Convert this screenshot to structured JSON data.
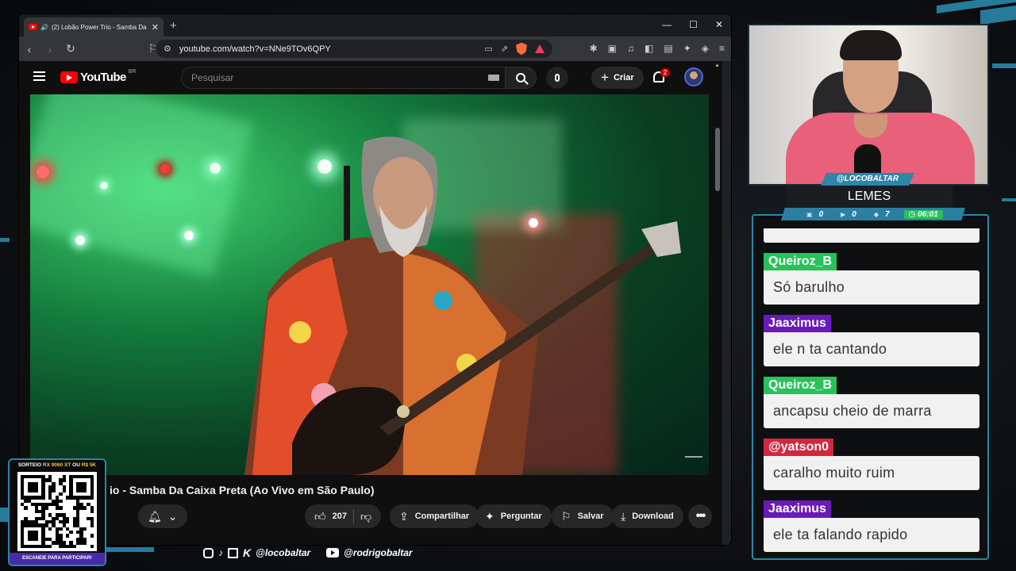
{
  "browser": {
    "tab_title": "(2) Lobão Power Trio - Samba Da C",
    "url": "youtube.com/watch?v=NNe9TOv6QPY"
  },
  "youtube": {
    "logo_text": "YouTube",
    "country_code": "BR",
    "search_placeholder": "Pesquisar",
    "create_label": "Criar",
    "notification_count": "2",
    "video_title": "io - Samba Da Caixa Preta (Ao Vivo em São Paulo)",
    "like_count": "207",
    "share_label": "Compartilhar",
    "ask_label": "Perguntar",
    "save_label": "Salvar",
    "download_label": "Download"
  },
  "stream": {
    "handle": "@LOCOBALTAR",
    "game_name": "LEMES",
    "stats": [
      "0",
      "0",
      "7"
    ],
    "timer": "06:01",
    "colors": {
      "accent": "#2b86a8",
      "green": "#27c25a",
      "purple": "#6a1ab8",
      "red": "#d3273f"
    }
  },
  "chat": {
    "messages": [
      {
        "user": "Queiroz_B",
        "color": "#27c25a",
        "text": "Só barulho"
      },
      {
        "user": "Jaaximus",
        "color": "#6a1ab8",
        "text": "ele n ta cantando"
      },
      {
        "user": "Queiroz_B",
        "color": "#27c25a",
        "text": "ancapsu cheio de marra"
      },
      {
        "user": "@yatson0",
        "color": "#d3273f",
        "text": "caralho muito ruim"
      },
      {
        "user": "Jaaximus",
        "color": "#6a1ab8",
        "text": "ele ta falando rapido"
      }
    ]
  },
  "sorteio": {
    "prefix": "SORTEIO ",
    "item1": "RX 9060 XT",
    "mid": " OU ",
    "item2": "R$ 5K",
    "bottom": "ESCANEIE PARA PARTICIPAR!"
  },
  "socials": {
    "handle1": "@locobaltar",
    "handle2": "@rodrigobaltar"
  }
}
